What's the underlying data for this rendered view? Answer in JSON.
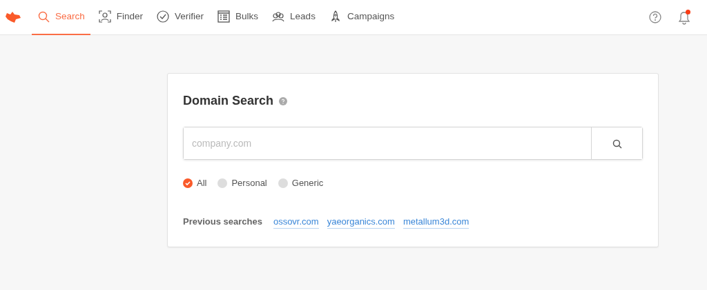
{
  "nav": {
    "tabs": [
      {
        "label": "Search",
        "kind": "search",
        "selected": true
      },
      {
        "label": "Finder",
        "kind": "finder",
        "selected": false
      },
      {
        "label": "Verifier",
        "kind": "verifier",
        "selected": false
      },
      {
        "label": "Bulks",
        "kind": "bulks",
        "selected": false
      },
      {
        "label": "Leads",
        "kind": "leads",
        "selected": false
      },
      {
        "label": "Campaigns",
        "kind": "campaigns",
        "selected": false
      }
    ],
    "notifications": {
      "unread": true
    }
  },
  "card": {
    "title": "Domain Search",
    "search": {
      "placeholder": "company.com"
    },
    "filters": [
      {
        "label": "All",
        "selected": true
      },
      {
        "label": "Personal",
        "selected": false
      },
      {
        "label": "Generic",
        "selected": false
      }
    ],
    "previous": {
      "label": "Previous searches",
      "links": [
        "ossovr.com",
        "yaeorganics.com",
        "metallum3d.com"
      ]
    }
  }
}
